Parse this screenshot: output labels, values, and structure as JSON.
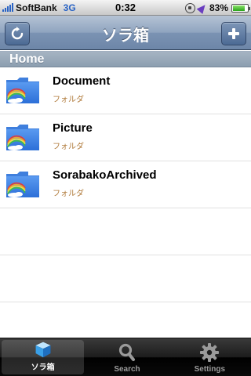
{
  "status_bar": {
    "carrier": "SoftBank",
    "network": "3G",
    "time": "0:32",
    "battery_percent": "83%",
    "battery_level": 0.83,
    "icons": [
      "signal-icon",
      "rotation-lock-icon",
      "location-icon",
      "battery-icon"
    ]
  },
  "nav_bar": {
    "title": "ソラ箱",
    "left_button_icon": "refresh-icon",
    "right_button_icon": "add-icon"
  },
  "section": {
    "title": "Home"
  },
  "items": [
    {
      "name": "Document",
      "kind": "フォルダ",
      "icon": "folder-icon"
    },
    {
      "name": "Picture",
      "kind": "フォルダ",
      "icon": "folder-icon"
    },
    {
      "name": "SorabakoArchived",
      "kind": "フォルダ",
      "icon": "folder-icon"
    }
  ],
  "tabs": [
    {
      "label": "ソラ箱",
      "icon": "box-icon",
      "selected": true
    },
    {
      "label": "Search",
      "icon": "search-icon",
      "selected": false
    },
    {
      "label": "Settings",
      "icon": "gear-icon",
      "selected": false
    }
  ],
  "colors": {
    "nav_bar": "#7b93b3",
    "section_header": "#98a9ba",
    "folder_blue": "#3b7fe3",
    "subtitle": "#b07a3a",
    "network": "#2a64c5"
  }
}
